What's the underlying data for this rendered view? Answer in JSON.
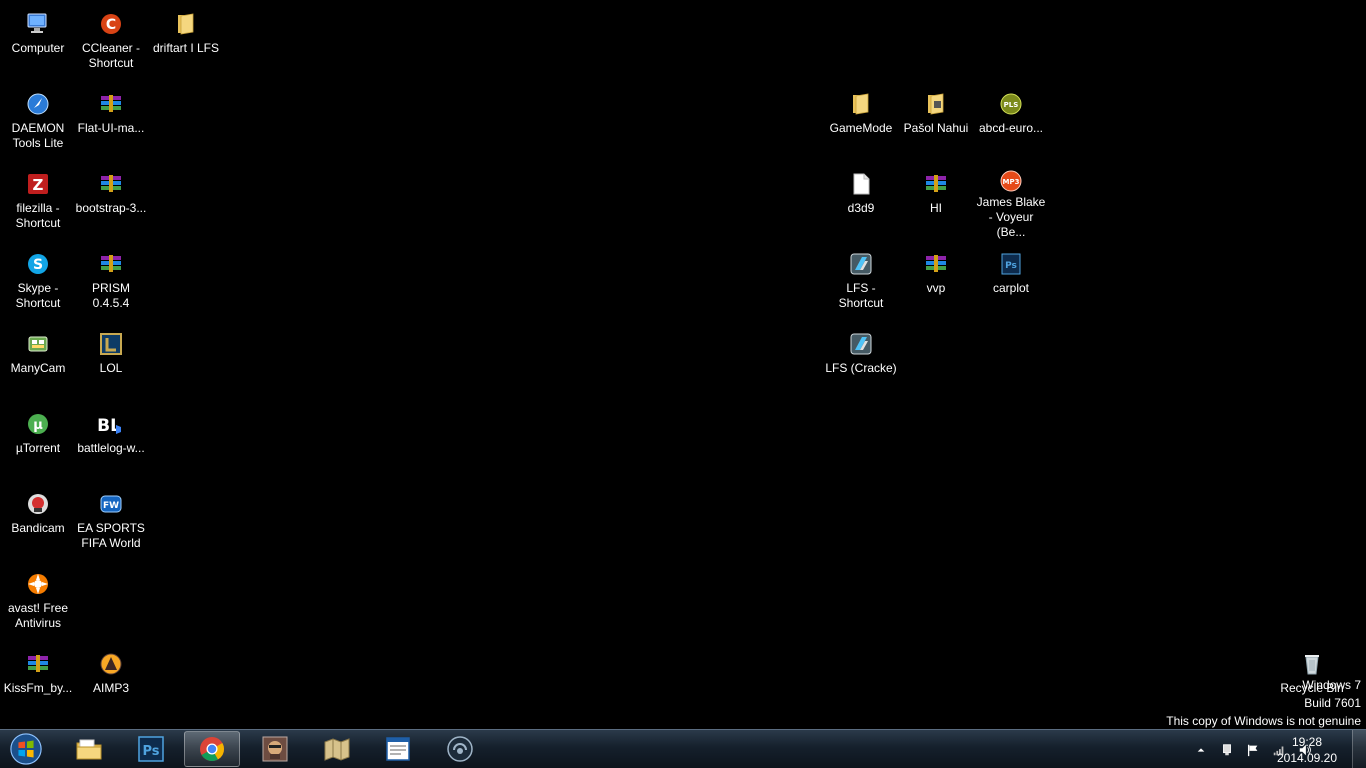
{
  "desktop_icons": {
    "computer": "Computer",
    "ccleaner": "CCleaner - Shortcut",
    "driftart": "driftart I LFS",
    "daemon": "DAEMON Tools Lite",
    "flatui": "Flat-UI-ma...",
    "filezilla": "filezilla - Shortcut",
    "bootstrap": "bootstrap-3...",
    "skype": "Skype - Shortcut",
    "prism": "PRISM 0.4.5.4",
    "manycam": "ManyCam",
    "lol": "LOL",
    "utorrent": "µTorrent",
    "battlelog": "battlelog-w...",
    "bandicam": "Bandicam",
    "easports": "EA SPORTS FIFA World",
    "avast": "avast! Free Antivirus",
    "kissfm": "KissFm_by...",
    "aimp": "AIMP3",
    "gamemode": "GameMode",
    "pasol": "Pašol Nahui",
    "abcd": "abcd-euro...",
    "d3d9": "d3d9",
    "hi": "HI",
    "jamesblake": "James Blake - Voyeur (Be...",
    "lfs_shortcut": "LFS - Shortcut",
    "vvp": "vvp",
    "carplot": "carplot",
    "lfs_cracked": "LFS (Cracke)",
    "recycle": "Recycle Bin"
  },
  "watermark": {
    "line1": "Windows 7",
    "line2": "Build 7601",
    "line3": "This copy of Windows is not genuine"
  },
  "taskbar": {
    "pinned": [
      "explorer",
      "photoshop",
      "chrome",
      "gta",
      "map",
      "document",
      "teamspeak"
    ],
    "active": "chrome"
  },
  "clock": {
    "time": "19:28",
    "date": "2014.09.20"
  },
  "colors": {
    "desktop_bg": "#000000",
    "taskbar_top": "#2b3a4a",
    "taskbar_bottom": "#0d141c",
    "label_text": "#ffffff"
  }
}
